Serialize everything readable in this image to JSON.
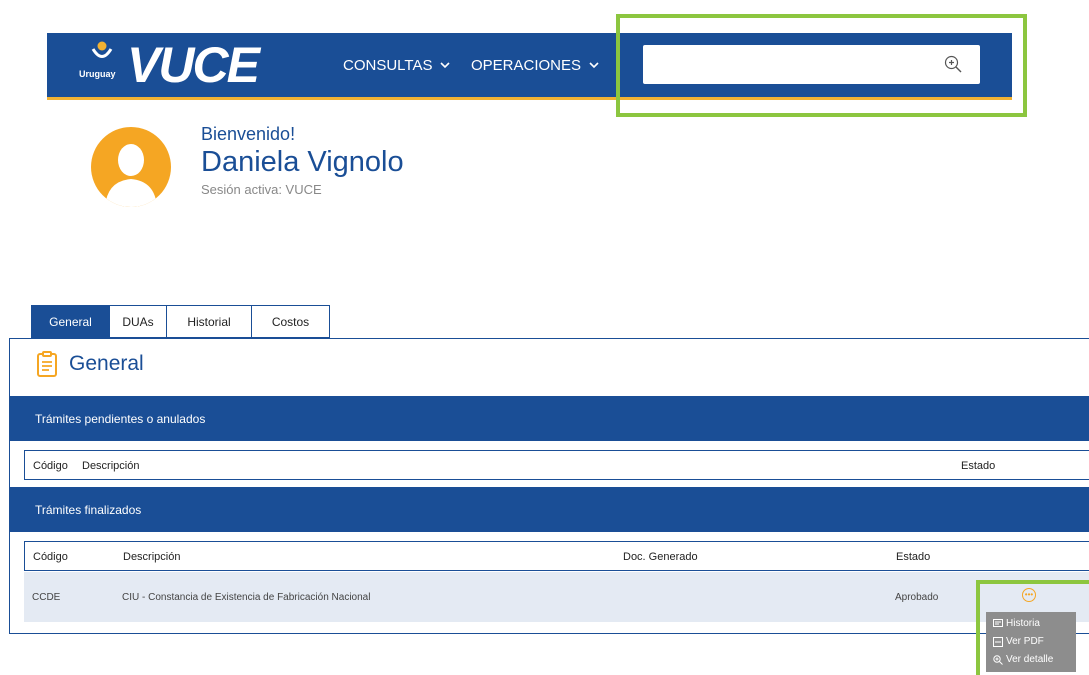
{
  "header": {
    "logo_country": "Uruguay",
    "logo_text": "VUCE",
    "nav": [
      {
        "label": "CONSULTAS",
        "icon": "chevron-down-icon"
      },
      {
        "label": "OPERACIONES",
        "icon": "chevron-down-icon"
      }
    ],
    "search": {
      "value": "",
      "placeholder": "",
      "icon": "zoom-in-icon"
    }
  },
  "user": {
    "greeting": "Bienvenido!",
    "name": "Daniela Vignolo",
    "session": "Sesión activa: VUCE"
  },
  "tabs": [
    "General",
    "DUAs",
    "Historial",
    "Costos"
  ],
  "active_tab": "General",
  "panel": {
    "title": "General",
    "pending": {
      "title": "Trámites pendientes o anulados",
      "columns": [
        "Código",
        "Descripción",
        "Estado"
      ]
    },
    "finished": {
      "title": "Trámites finalizados",
      "columns": [
        "Código",
        "Descripción",
        "Doc. Generado",
        "Estado"
      ],
      "rows": [
        {
          "codigo": "CCDE",
          "descripcion": "CIU - Constancia de Existencia de Fabricación Nacional",
          "doc": "",
          "estado": "Aprobado"
        }
      ]
    }
  },
  "row_menu": [
    {
      "label": "Historia",
      "icon": "history-icon"
    },
    {
      "label": "Ver PDF",
      "icon": "pdf-icon"
    },
    {
      "label": "Ver detalle",
      "icon": "zoom-icon"
    }
  ],
  "colors": {
    "primary": "#1a4e96",
    "accent": "#f5a623",
    "highlight": "#8cc63f",
    "row_bg": "#e4eaf3",
    "menu_bg": "#8d8d8d"
  }
}
